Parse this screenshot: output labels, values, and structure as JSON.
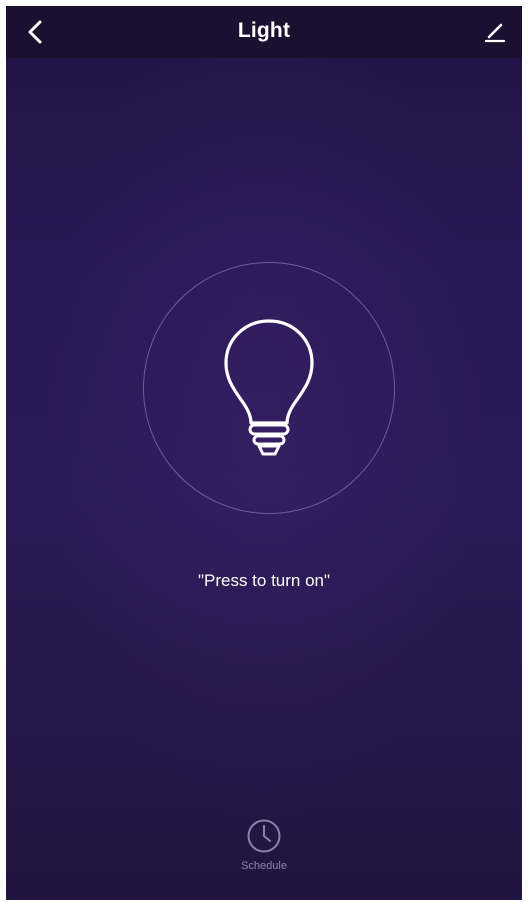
{
  "header": {
    "title": "Light",
    "back_icon": "chevron-left-icon",
    "edit_icon": "pencil-icon"
  },
  "device": {
    "state": "off",
    "icon": "lightbulb-icon",
    "hint": "\"Press to turn on\""
  },
  "footer": {
    "schedule_label": "Schedule",
    "schedule_icon": "clock-icon"
  },
  "colors": {
    "background_top": "#211444",
    "background_mid": "#2c1a57",
    "header_bar": "#1b1030",
    "ring": "#aa8cd2",
    "text": "#ffffff",
    "muted": "#8e82a6"
  }
}
